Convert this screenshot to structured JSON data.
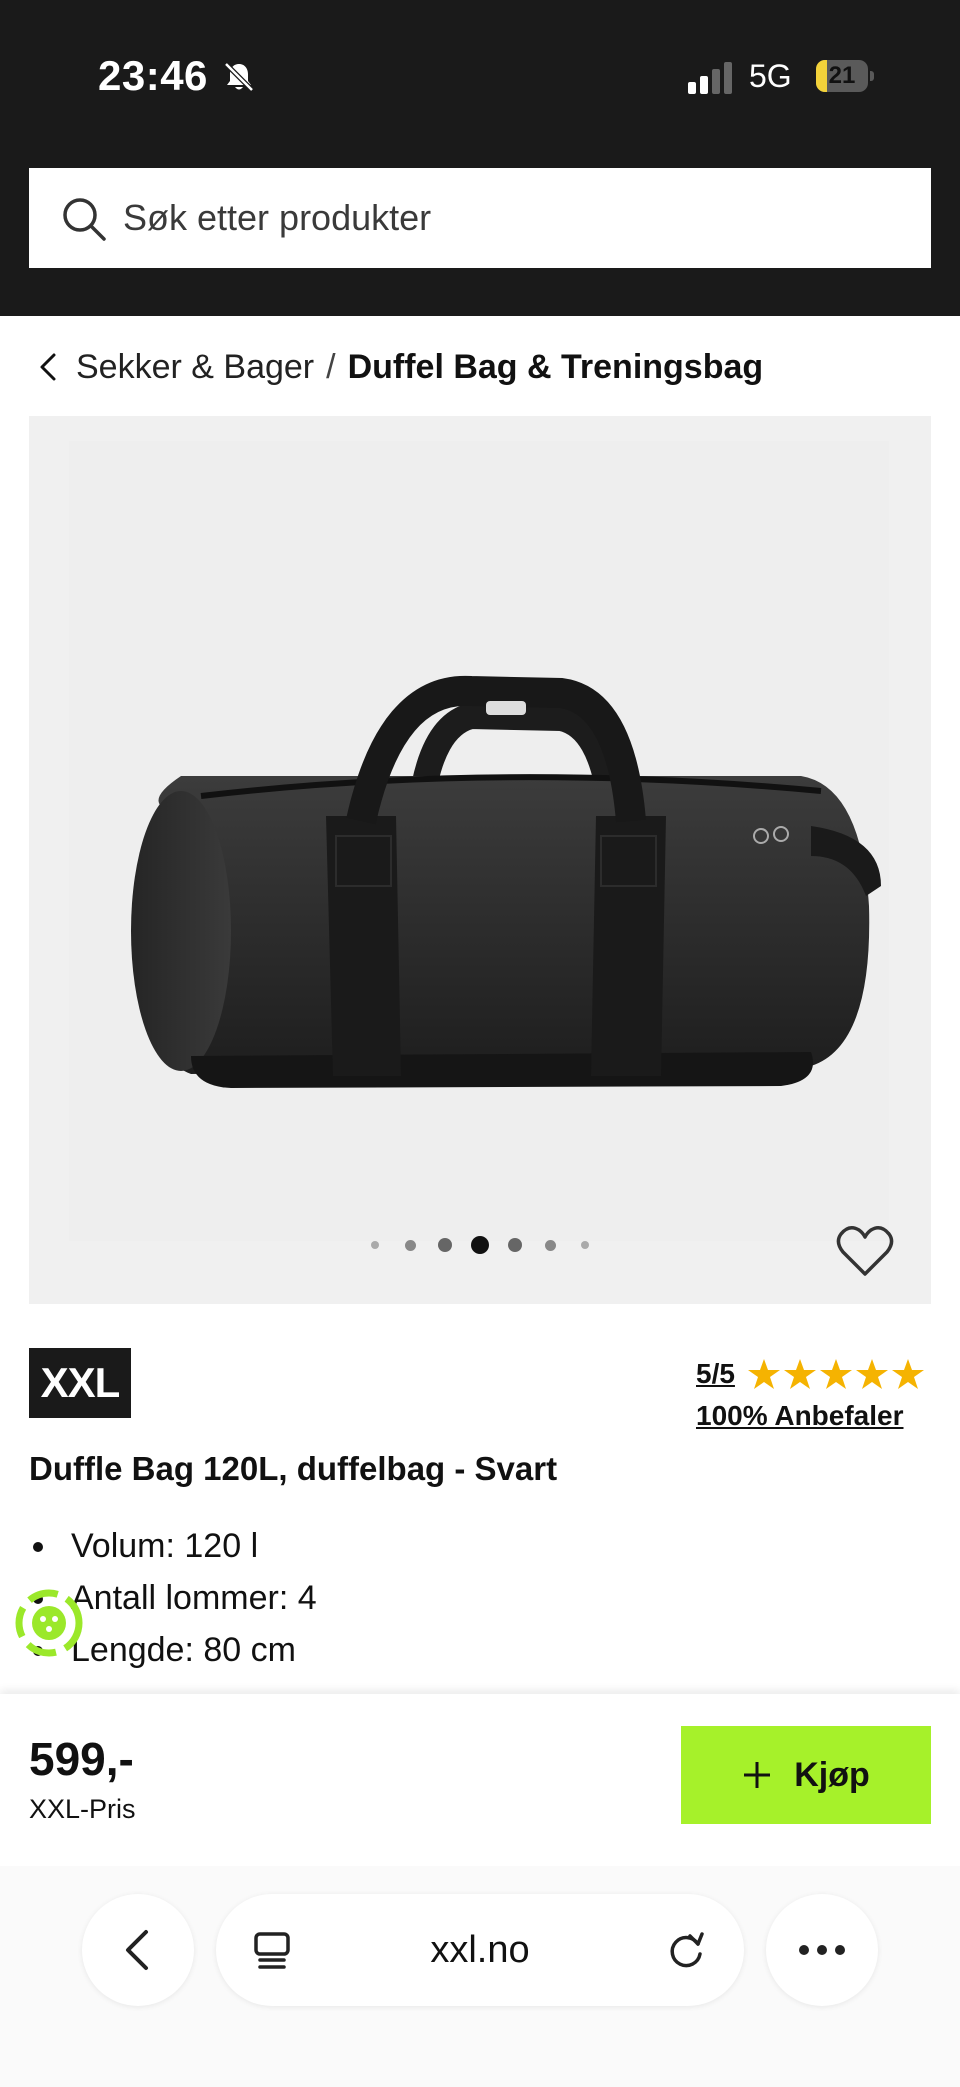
{
  "status_bar": {
    "time": "23:46",
    "network": "5G",
    "battery": "21",
    "battery_level": 0.21,
    "icons": [
      "bell-slash-icon",
      "signal-icon"
    ]
  },
  "search": {
    "placeholder": "Søk etter produkter",
    "icon": "search-icon"
  },
  "breadcrumb": {
    "parent": "Sekker & Bager",
    "separator": "/",
    "current": "Duffel Bag & Treningsbag"
  },
  "gallery": {
    "image_count": 7,
    "active_index": 3,
    "favorite_icon": "heart-outline-icon"
  },
  "product": {
    "brand": "XXL",
    "rating_text": "5/5",
    "rating_value": 5,
    "rating_max": 5,
    "recommend_text": "100% Anbefaler",
    "title": "Duffle Bag 120L, duffelbag - Svart",
    "specs": [
      "Volum: 120 l",
      "Antall lommer: 4",
      "Lengde: 80 cm"
    ]
  },
  "buy_bar": {
    "price": "599,-",
    "price_label": "XXL-Pris",
    "buy_label": "Kjøp",
    "accent": "#a6f12a"
  },
  "browser": {
    "url": "xxl.no",
    "icons": [
      "back-chevron-icon",
      "tabs-icon",
      "reload-icon",
      "more-icon"
    ]
  }
}
